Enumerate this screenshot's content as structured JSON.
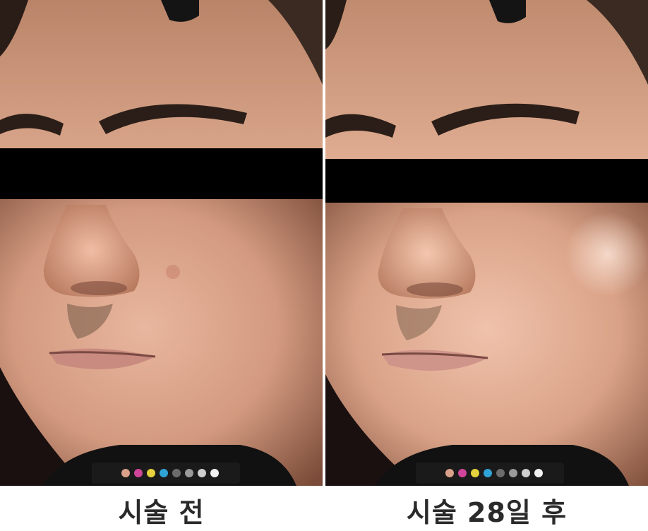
{
  "captions": {
    "before": "시술 전",
    "after": "시술 28일 후"
  },
  "colors": {
    "background": "#ffffff",
    "caption_text": "#2a2a2a",
    "censor_bar": "#000000",
    "skin_light": "#e6b199",
    "skin_mid": "#c98e74",
    "skin_shadow": "#8a5a44",
    "dark_backdrop": "#0b0b0b"
  },
  "color_chart_swatches": [
    "#d9a08a",
    "#d0459a",
    "#e5d23c",
    "#2fa3d6",
    "#6c6c6c",
    "#9a9a9a",
    "#cfcfcf",
    "#f2f2f2"
  ]
}
